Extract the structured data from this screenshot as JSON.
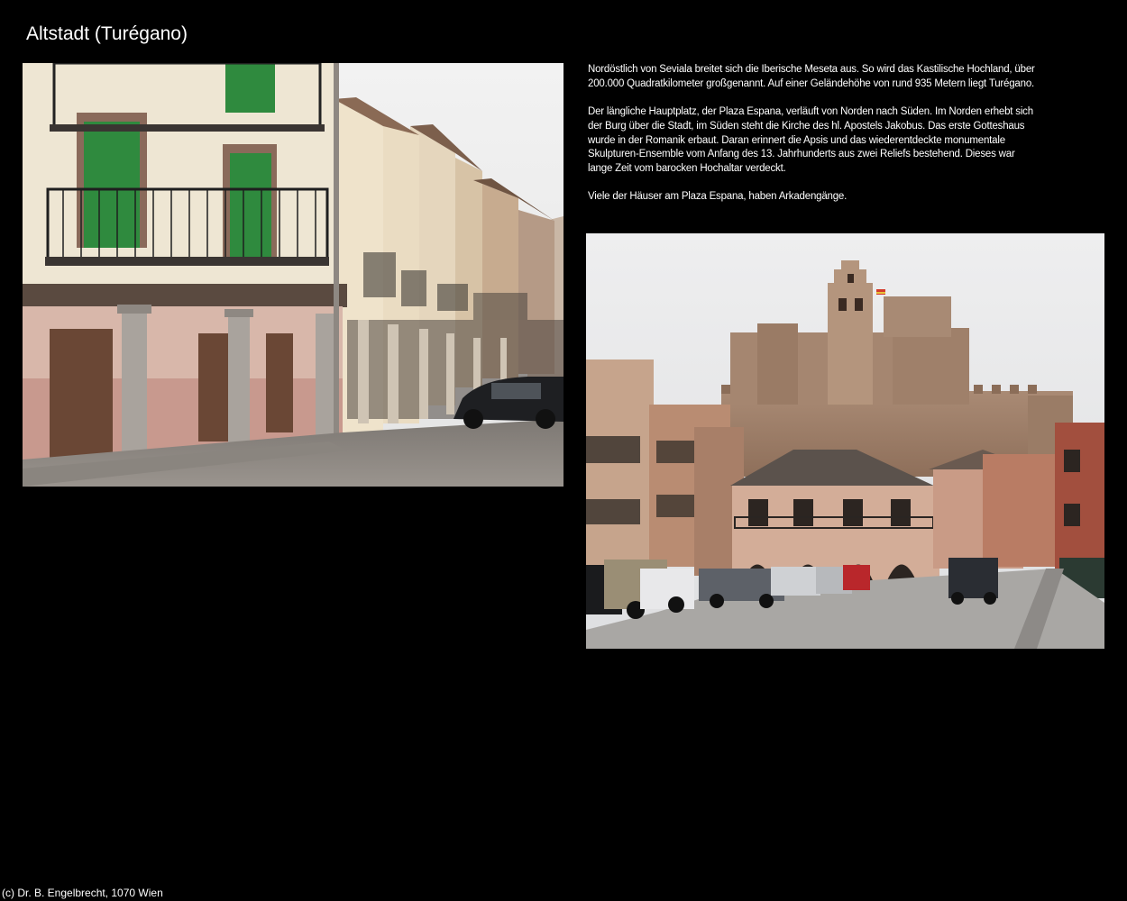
{
  "page": {
    "title": "Altstadt (Turégano)",
    "footer": "(c) Dr. B. Engelbrecht, 1070 Wien",
    "background_color": "#000000",
    "text_color": "#ffffff"
  },
  "description": {
    "paragraphs": [
      "Nordöstlich von Seviala breitet sich die Iberische Meseta aus. So wird das Kastilische Hochland, über 200.000 Quadratkilometer großgenannt. Auf einer Geländehöhe von rund 935 Metern liegt Turégano.",
      "Der längliche Hauptplatz, der Plaza Espana, verläuft von Norden nach Süden. Im Norden erhebt sich der Burg über die Stadt, im Süden steht die Kirche des hl. Apostels Jakobus. Das erste Gotteshaus wurde in der Romanik erbaut. Daran erinnert die Apsis und das wiederentdeckte monumentale Skulpturen-Ensemble vom Anfang des 13. Jahrhunderts aus zwei Reliefs bestehend. Dieses war lange Zeit vom barocken Hochaltar verdeckt.",
      "Viele der Häuser am Plaza Espana, haben Arkadengänge."
    ]
  }
}
